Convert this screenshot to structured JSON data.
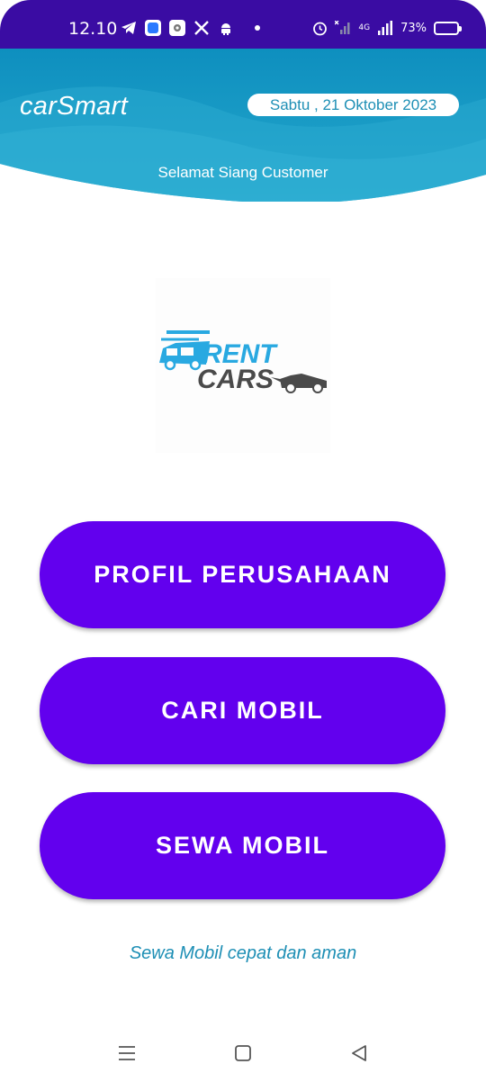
{
  "status_bar": {
    "time": "12.10",
    "battery": "73%",
    "network": "4G",
    "battery_level": 0.73,
    "icons_left": [
      "telegram-icon",
      "app-blue-icon",
      "settings-icon",
      "x-icon",
      "android-icon"
    ],
    "icons_right": [
      "alarm-icon",
      "signal-icon",
      "battery-icon"
    ]
  },
  "header": {
    "title": "carSmart",
    "date": "Sabtu , 21 Oktober 2023",
    "greeting": "Selamat Siang Customer"
  },
  "logo": {
    "line1": "RENT",
    "line2": "CARS"
  },
  "menu": {
    "profile": "PROFIL PERUSAHAAN",
    "search": "CARI MOBIL",
    "rent": "SEWA MOBIL"
  },
  "tagline": "Sewa Mobil cepat dan aman",
  "colors": {
    "status_bar": "#3a0ca3",
    "header_wave": "#1e9ec4",
    "button": "#6200ee",
    "accent_text": "#1e8fb5",
    "logo_blue": "#29a9e1",
    "logo_gray": "#4a4a4a"
  },
  "nav_icons": [
    "menu-icon",
    "home-icon",
    "back-icon"
  ]
}
